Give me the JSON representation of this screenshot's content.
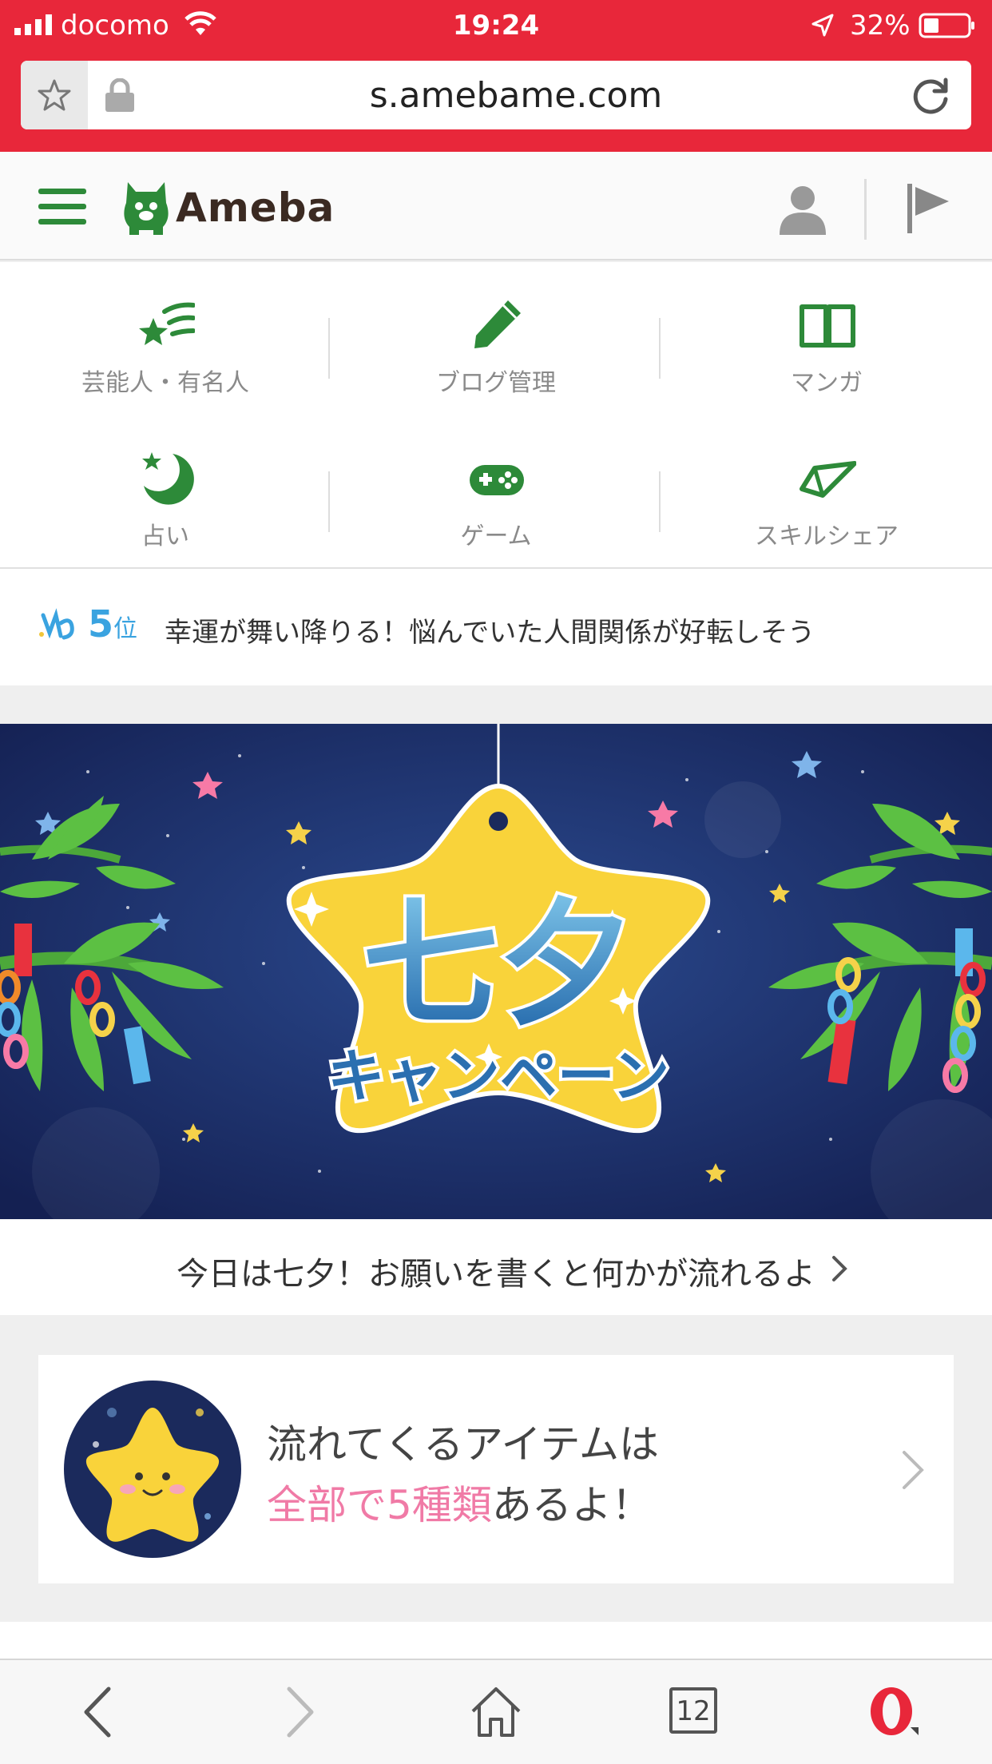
{
  "status_bar": {
    "carrier": "docomo",
    "time": "19:24",
    "battery_percent": "32%"
  },
  "url_bar": {
    "url": "s.amebame.com"
  },
  "header": {
    "logo_text": "Ameba"
  },
  "menu": {
    "items": [
      {
        "label": "芸能人・有名人",
        "icon": "celebrity-star-icon"
      },
      {
        "label": "ブログ管理",
        "icon": "pencil-icon"
      },
      {
        "label": "マンガ",
        "icon": "book-icon"
      },
      {
        "label": "占い",
        "icon": "moon-star-icon"
      },
      {
        "label": "ゲーム",
        "icon": "gamepad-icon"
      },
      {
        "label": "スキルシェア",
        "icon": "paper-plane-icon"
      }
    ]
  },
  "fortune": {
    "rank_number": "5",
    "rank_unit": "位",
    "message": "幸運が舞い降りる！悩んでいた人間関係が好転しそう"
  },
  "banner": {
    "title": "七夕",
    "subtitle": "キャンペーン",
    "caption": "今日は七夕！お願いを書くと何かが流れるよ"
  },
  "info_card": {
    "line1": "流れてくるアイテムは",
    "line2_highlight": "全部で5種類",
    "line2_rest": "あるよ！"
  },
  "toolbar": {
    "tab_count": "12"
  },
  "colors": {
    "browser_red": "#e8273a",
    "ameba_green": "#2d8a39",
    "rank_blue": "#3aa3e0",
    "highlight_pink": "#f07aa6",
    "banner_navy": "#1b2a5c",
    "star_yellow": "#f9d33a"
  }
}
